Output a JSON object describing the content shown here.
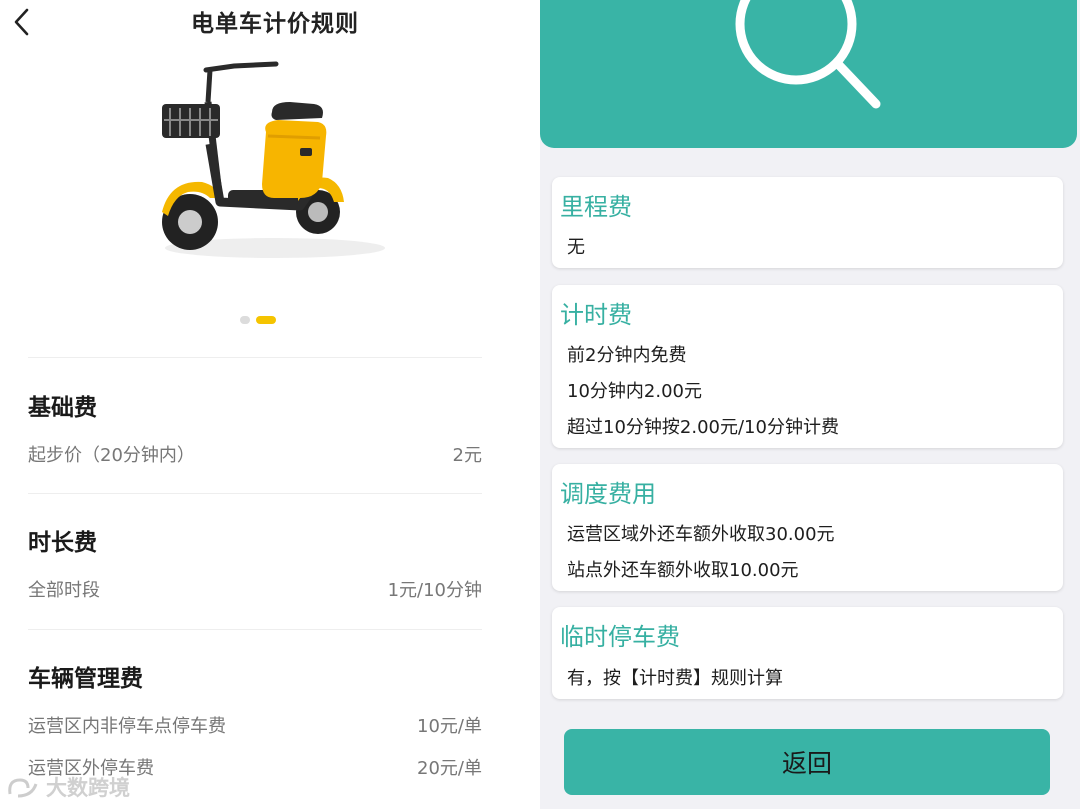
{
  "left_screen": {
    "title": "电单车计价规则",
    "sections": [
      {
        "title": "基础费",
        "rows": [
          {
            "label": "起步价（20分钟内）",
            "value": "2元"
          }
        ]
      },
      {
        "title": "时长费",
        "rows": [
          {
            "label": "全部时段",
            "value": "1元/10分钟"
          }
        ]
      },
      {
        "title": "车辆管理费",
        "rows": [
          {
            "label": "运营区内非停车点停车费",
            "value": "10元/单"
          },
          {
            "label": "运营区外停车费",
            "value": "20元/单"
          }
        ]
      }
    ],
    "carousel": {
      "count": 2,
      "active_index": 1
    },
    "watermark": "大数跨境"
  },
  "right_screen": {
    "cards": [
      {
        "title": "里程费",
        "lines": [
          "无"
        ]
      },
      {
        "title": "计时费",
        "lines": [
          "前2分钟内免费",
          "10分钟内2.00元",
          "超过10分钟按2.00元/10分钟计费"
        ]
      },
      {
        "title": "调度费用",
        "lines": [
          "运营区域外还车额外收取30.00元",
          "站点外还车额外收取10.00元"
        ]
      },
      {
        "title": "临时停车费",
        "lines": [
          "有，按【计时费】规则计算"
        ]
      }
    ],
    "return_label": "返回"
  },
  "colors": {
    "teal": "#39b4a6",
    "teal_text": "#37b0a2",
    "yellow": "#f5c400"
  },
  "icons": {
    "back": "chevron-left-icon",
    "search": "search-icon"
  }
}
